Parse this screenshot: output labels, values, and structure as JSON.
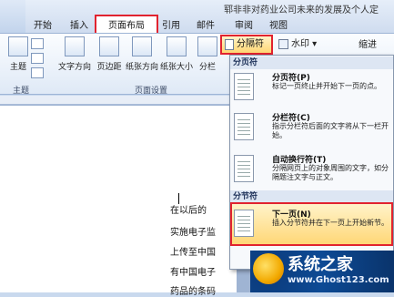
{
  "window": {
    "title": "郓非非对药业公司未来的发展及个人定"
  },
  "tabs": [
    {
      "label": "开始"
    },
    {
      "label": "插入"
    },
    {
      "label": "页面布局"
    },
    {
      "label": "引用"
    },
    {
      "label": "邮件"
    },
    {
      "label": "审阅"
    },
    {
      "label": "视图"
    }
  ],
  "ribbon": {
    "theme_label": "主题",
    "text_direction": "文字方向",
    "margins": "页边距",
    "orientation": "纸张方向",
    "size": "纸张大小",
    "columns": "分栏",
    "breaks": "分隔符",
    "watermark": "水印",
    "indent": "缩进",
    "group_theme": "主题",
    "group_page_setup": "页面设置"
  },
  "breaks_menu": {
    "page_breaks_header": "分页符",
    "section_breaks_header": "分节符",
    "items": [
      {
        "title": "分页符(P)",
        "desc": "标记一页终止并开始下一页的点。"
      },
      {
        "title": "分栏符(C)",
        "desc": "指示分栏符后面的文字将从下一栏开始。"
      },
      {
        "title": "自动换行符(T)",
        "desc": "分隔网页上的对象周围的文字，如分隔题注文字与正文。"
      },
      {
        "title": "下一页(N)",
        "desc": "插入分节符并在下一页上开始新节。"
      }
    ]
  },
  "document": {
    "lines": [
      "在以后的",
      "实施电子监",
      "上传至中国",
      "有中国电子",
      "药品的条码"
    ]
  },
  "logo": {
    "title": "系统之家",
    "url": "www.Ghost123.com"
  },
  "colors": {
    "highlight_border": "#e1232f",
    "selected_item_bg": "#ffd777",
    "ribbon_bg": "#dfe9f6"
  }
}
